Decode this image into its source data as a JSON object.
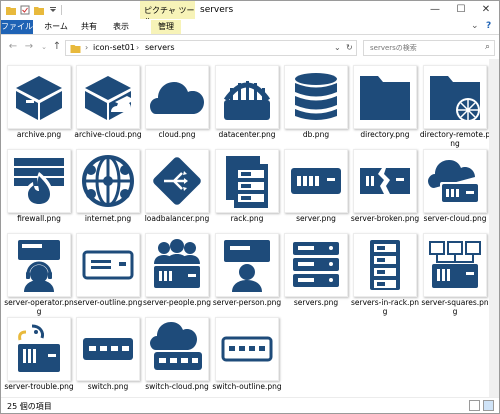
{
  "window": {
    "title": "servers",
    "contextual_tab_group": "ピクチャ ツール",
    "controls": {
      "minimize": "—",
      "maximize": "☐",
      "close": "✕"
    }
  },
  "ribbon": {
    "tabs": [
      "ファイル",
      "ホーム",
      "共有",
      "表示",
      "管理"
    ]
  },
  "address": {
    "breadcrumb": [
      "icon-set01",
      "servers"
    ],
    "search_placeholder": "serversの検索"
  },
  "files": [
    {
      "name": "archive.png",
      "icon": "archive-icon"
    },
    {
      "name": "archive-cloud.png",
      "icon": "archive-cloud-icon"
    },
    {
      "name": "cloud.png",
      "icon": "cloud-icon"
    },
    {
      "name": "datacenter.png",
      "icon": "datacenter-icon"
    },
    {
      "name": "db.png",
      "icon": "database-icon"
    },
    {
      "name": "directory.png",
      "icon": "folder-icon"
    },
    {
      "name": "directory-remote.png",
      "icon": "folder-remote-icon"
    },
    {
      "name": "firewall.png",
      "icon": "firewall-icon"
    },
    {
      "name": "internet.png",
      "icon": "globe-icon"
    },
    {
      "name": "loadbalancer.png",
      "icon": "loadbalancer-icon"
    },
    {
      "name": "rack.png",
      "icon": "rack-icon"
    },
    {
      "name": "server.png",
      "icon": "server-icon"
    },
    {
      "name": "server-broken.png",
      "icon": "server-broken-icon"
    },
    {
      "name": "server-cloud.png",
      "icon": "server-cloud-icon"
    },
    {
      "name": "server-operator.png",
      "icon": "server-operator-icon"
    },
    {
      "name": "server-outline.png",
      "icon": "server-outline-icon"
    },
    {
      "name": "server-people.png",
      "icon": "server-people-icon"
    },
    {
      "name": "server-person.png",
      "icon": "server-person-icon"
    },
    {
      "name": "servers.png",
      "icon": "servers-icon"
    },
    {
      "name": "servers-in-rack.png",
      "icon": "servers-in-rack-icon"
    },
    {
      "name": "server-squares.png",
      "icon": "server-squares-icon"
    },
    {
      "name": "server-trouble.png",
      "icon": "server-trouble-icon"
    },
    {
      "name": "switch.png",
      "icon": "switch-icon"
    },
    {
      "name": "switch-cloud.png",
      "icon": "switch-cloud-icon"
    },
    {
      "name": "switch-outline.png",
      "icon": "switch-outline-icon"
    }
  ],
  "status": {
    "item_count": "25 個の項目"
  },
  "colors": {
    "icon": "#1e4b7a",
    "file_tab": "#1f63b5",
    "tools_tab": "#f7f3b8"
  }
}
